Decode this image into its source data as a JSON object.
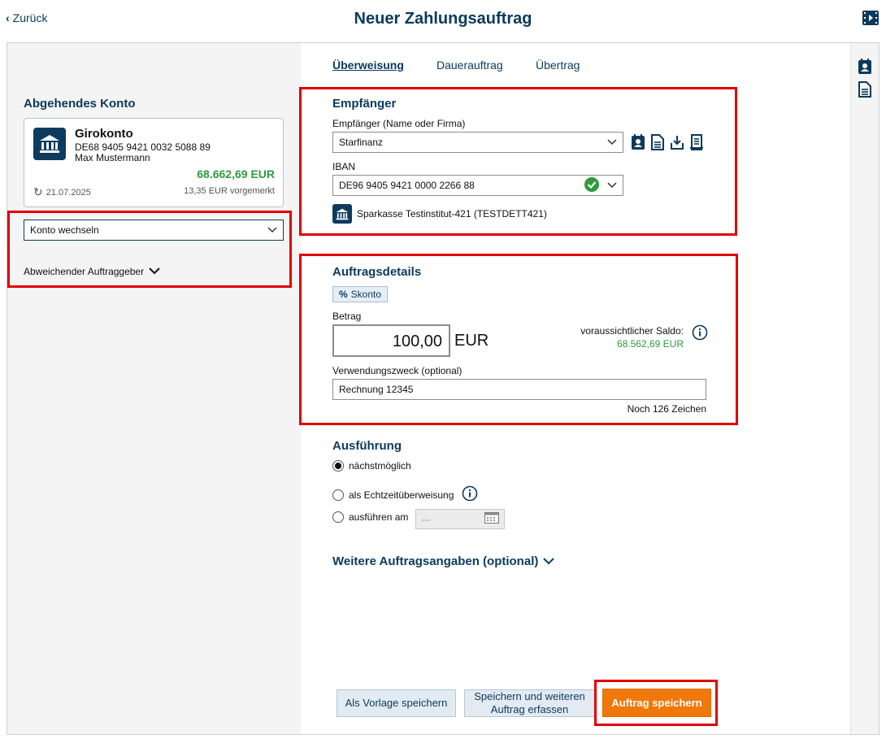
{
  "header": {
    "back_label": "Zurück",
    "title": "Neuer Zahlungsauftrag"
  },
  "tabs": [
    "Überweisung",
    "Dauerauftrag",
    "Übertrag"
  ],
  "account": {
    "section_title": "Abgehendes Konto",
    "name": "Girokonto",
    "iban": "DE68 9405 9421 0032 5088 89",
    "owner": "Max Mustermann",
    "balance": "68.662,69 EUR",
    "date": "21.07.2025",
    "reserved": "13,35 EUR vorgemerkt",
    "switch_label": "Konto wechseln",
    "other_payer_label": "Abweichender Auftraggeber"
  },
  "recipient": {
    "section_title": "Empfänger",
    "name_label": "Empfänger (Name oder Firma)",
    "name_value": "Starfinanz",
    "iban_label": "IBAN",
    "iban_value": "DE96 9405 9421 0000 2266 88",
    "bank_name": "Sparkasse Testinstitut-421 (TESTDETT421)"
  },
  "details": {
    "section_title": "Auftragsdetails",
    "skonto_label": "Skonto",
    "amount_label": "Betrag",
    "amount_value": "100,00",
    "currency": "EUR",
    "expected_balance_label": "voraussichtlicher Saldo:",
    "expected_balance_value": "68.562,69 EUR",
    "purpose_label": "Verwendungszweck (optional)",
    "purpose_value": "Rechnung 12345",
    "chars_left": "Noch 126 Zeichen"
  },
  "execution": {
    "section_title": "Ausführung",
    "options": [
      "nächstmöglich",
      "als Echtzeitüberweisung",
      "ausführen am"
    ],
    "selected_index": 0,
    "date_placeholder": "---"
  },
  "more": {
    "label": "Weitere Auftragsangaben (optional)"
  },
  "buttons": {
    "template": "Als Vorlage speichern",
    "save_and_new_line1": "Speichern und weiteren",
    "save_and_new_line2": "Auftrag erfassen",
    "save": "Auftrag speichern"
  },
  "colors": {
    "brand_navy": "#0b3a5c",
    "positive_green": "#2e9a3c",
    "primary_orange": "#f0780a",
    "highlight_red": "#e00000"
  }
}
